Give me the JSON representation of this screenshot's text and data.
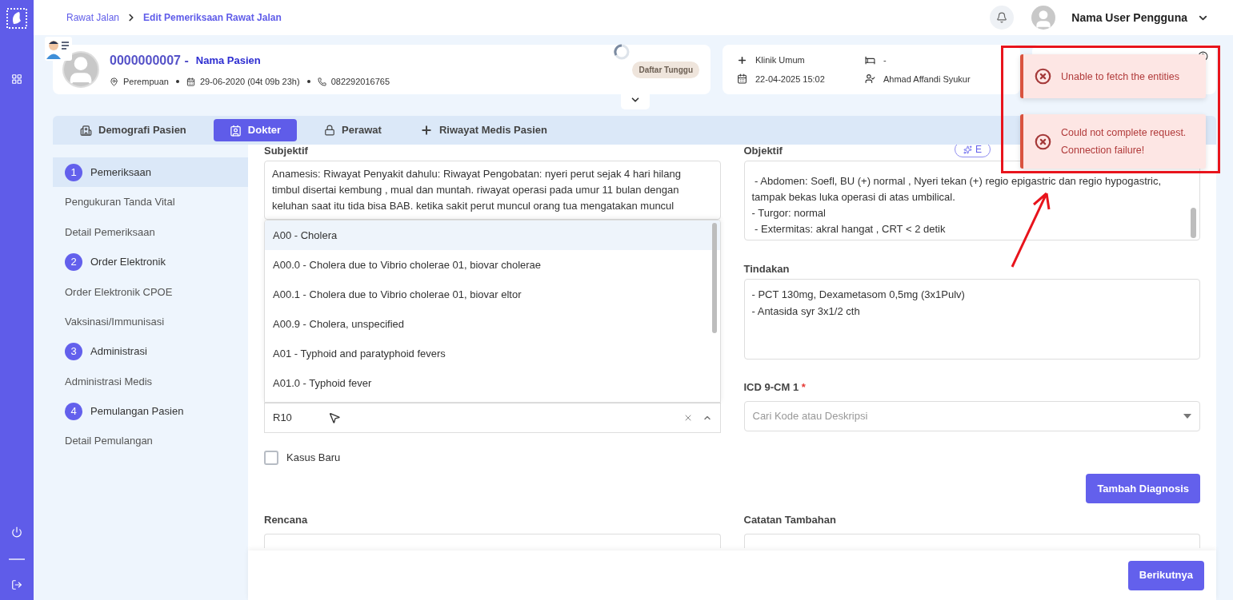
{
  "breadcrumb": [
    {
      "label": "Rawat Jalan",
      "current": false
    },
    {
      "label": "Edit Pemeriksaan Rawat Jalan",
      "current": true
    }
  ],
  "user": {
    "name": "Nama User Pengguna"
  },
  "patient": {
    "id": "0000000007 -",
    "name": "Nama Pasien",
    "gender": "Perempuan",
    "dob": "29-06-2020 (04t 09b 23h)",
    "phone": "082292016765",
    "status": "Daftar Tunggu"
  },
  "visit": {
    "clinic": "Klinik Umum",
    "date": "22-04-2025 15:02",
    "bed": "-",
    "doctor": "Ahmad Affandi Syukur"
  },
  "tabs": [
    {
      "label": "Demografi Pasien",
      "selected": false
    },
    {
      "label": "Dokter",
      "selected": true
    },
    {
      "label": "Perawat",
      "selected": false
    },
    {
      "label": "Riwayat Medis Pasien",
      "selected": false
    }
  ],
  "steps": [
    {
      "kind": "step",
      "number": "1",
      "label": "Pemeriksaan",
      "selected": true
    },
    {
      "kind": "sub",
      "label": "Pengukuran Tanda Vital",
      "selected": false
    },
    {
      "kind": "sub",
      "label": "Detail Pemeriksaan",
      "selected": false
    },
    {
      "kind": "step",
      "number": "2",
      "label": "Order Elektronik",
      "selected": false
    },
    {
      "kind": "sub",
      "label": "Order Elektronik CPOE",
      "selected": false
    },
    {
      "kind": "sub",
      "label": "Vaksinasi/Immunisasi",
      "selected": false
    },
    {
      "kind": "step",
      "number": "3",
      "label": "Administrasi",
      "selected": false
    },
    {
      "kind": "sub",
      "label": "Administrasi Medis",
      "selected": false
    },
    {
      "kind": "step",
      "number": "4",
      "label": "Pemulangan Pasien",
      "selected": false
    },
    {
      "kind": "sub",
      "label": "Detail Pemulangan",
      "selected": false
    }
  ],
  "subjektif": {
    "label": "Subjektif",
    "lines": [
      "Anamesis: Riwayat Penyakit dahulu: Riwayat Pengobatan: nyeri perut sejak 4 hari hilang",
      "timbul disertai kembung , mual dan muntah. riwayat operasi pada umur 11 bulan dengan",
      "keluhan saat itu tida bisa BAB. ketika sakit perut muncul orang tua mengatakan muncul"
    ]
  },
  "diagnosis_dropdown": {
    "options": [
      {
        "label": "A00 - Cholera",
        "selected": true
      },
      {
        "label": "A00.0 - Cholera due to Vibrio cholerae 01, biovar cholerae",
        "selected": false
      },
      {
        "label": "A00.1 - Cholera due to Vibrio cholerae 01, biovar eltor",
        "selected": false
      },
      {
        "label": "A00.9 - Cholera, unspecified",
        "selected": false
      },
      {
        "label": "A01 - Typhoid and paratyphoid fevers",
        "selected": false
      },
      {
        "label": "A01.0 - Typhoid fever",
        "selected": false
      }
    ],
    "value": "R10"
  },
  "kasus_baru": {
    "label": "Kasus Baru",
    "checked": false
  },
  "objektif": {
    "label": "Objektif",
    "edit_button": "E",
    "lines": [
      " - Abdomen: Soefl, BU (+) normal , Nyeri tekan (+) regio epigastric dan regio hypogastric,",
      "tampak bekas luka operasi di atas umbilical.",
      "- Turgor: normal",
      " - Extermitas: akral hangat , CRT < 2 detik"
    ]
  },
  "tindakan": {
    "label": "Tindakan",
    "lines": [
      "- PCT 130mg, Dexametasom 0,5mg (3x1Pulv)",
      "- Antasida syr 3x1/2 cth"
    ]
  },
  "icd9": {
    "label": "ICD 9-CM 1",
    "required_mark": "*",
    "placeholder": "Cari Kode atau Deskripsi"
  },
  "add_diagnosis": "Tambah Diagnosis",
  "rencana": {
    "label": "Rencana"
  },
  "catatan": {
    "label": "Catatan Tambahan"
  },
  "next_button": "Berikutnya",
  "toasts": [
    "Unable to fetch the entities",
    "Could not complete request. Connection failure!"
  ]
}
